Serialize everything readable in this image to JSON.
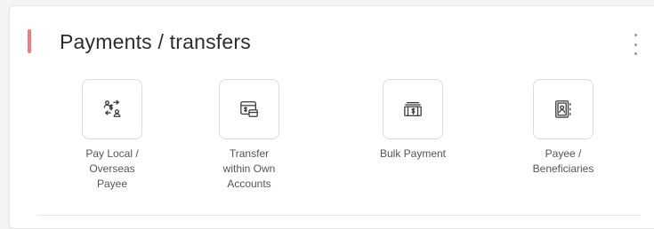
{
  "section": {
    "title": "Payments / transfers",
    "accent_color": "#f07b7b"
  },
  "actions": [
    {
      "label": "Pay Local /\nOverseas\nPayee",
      "icon": "pay-transfer-icon"
    },
    {
      "label": "Transfer\nwithin Own\nAccounts",
      "icon": "card-transfer-icon"
    },
    {
      "label": "Bulk Payment",
      "icon": "cash-stack-icon"
    },
    {
      "label": "Payee /\nBeneficiaries",
      "icon": "contact-book-icon"
    }
  ]
}
